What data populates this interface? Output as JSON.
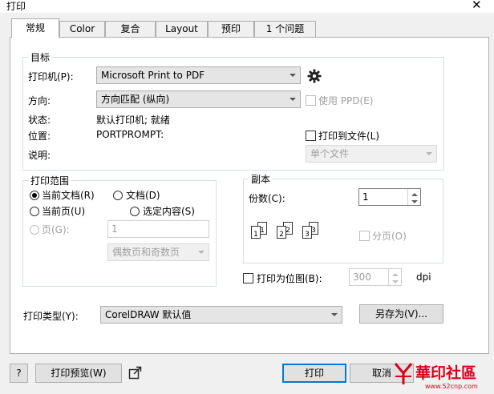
{
  "window": {
    "title": "打印"
  },
  "tabs": [
    {
      "label": "常规",
      "active": true
    },
    {
      "label": "Color"
    },
    {
      "label": "复合"
    },
    {
      "label": "Layout"
    },
    {
      "label": "预印"
    },
    {
      "label": "1 个问题"
    }
  ],
  "target": {
    "legend": "目标",
    "printer_label": "打印机(P):",
    "printer_value": "Microsoft Print to PDF",
    "orientation_label": "方向:",
    "orientation_value": "方向匹配 (纵向)",
    "use_ppd_label": "使用 PPD(E)",
    "status_label": "状态:",
    "status_value": "默认打印机; 就绪",
    "location_label": "位置:",
    "location_value": "PORTPROMPT:",
    "print_to_file_label": "打印到文件(L)",
    "comment_label": "说明:",
    "file_mode_value": "单个文件"
  },
  "print_range": {
    "legend": "打印范围",
    "current_document": "当前文档(R)",
    "documents": "文档(D)",
    "current_page": "当前页(U)",
    "selection": "选定内容(S)",
    "pages": "页(G):",
    "pages_value": "1",
    "page_filter_value": "偶数页和奇数页"
  },
  "copies": {
    "legend": "副本",
    "count_label": "份数(C):",
    "count_value": "1",
    "collate_label": "分页(O)",
    "collate_pages": [
      "1",
      "1",
      "2",
      "2",
      "3",
      "3"
    ]
  },
  "print_as_bitmap": {
    "label": "打印为位图(B):",
    "dpi_value": "300",
    "unit": "dpi"
  },
  "print_type": {
    "label": "打印类型(Y):",
    "value": "CorelDRAW 默认值",
    "save_as": "另存为(V)..."
  },
  "footer": {
    "help": "?",
    "preview": "打印预览(W)",
    "print": "打印",
    "cancel": "取消"
  },
  "watermark": {
    "brand": "華印社區",
    "url": "www.52cnp.com",
    "accent": "#d9001b"
  }
}
